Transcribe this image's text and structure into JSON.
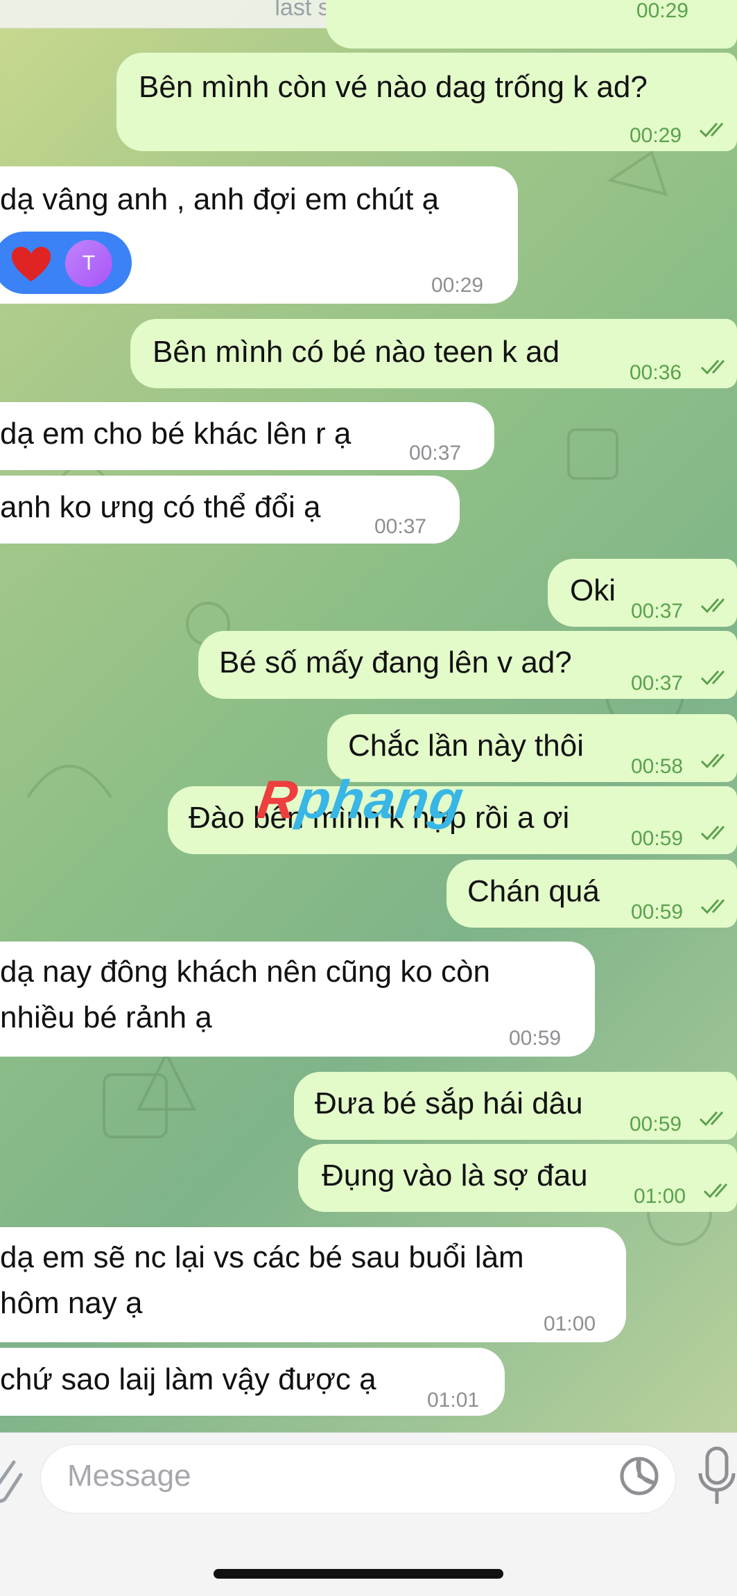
{
  "header": {
    "status": "last seen just now"
  },
  "messages": [
    {
      "dir": "out",
      "text": "",
      "time": "00:29"
    },
    {
      "dir": "out",
      "text": "Bên mình còn vé nào dag trống k ad?",
      "time": "00:29"
    },
    {
      "dir": "in",
      "text": "dạ vâng anh , anh đợi em chút ạ",
      "time": "00:29",
      "reaction": {
        "emoji": "❤️",
        "user_initial": "T"
      }
    },
    {
      "dir": "out",
      "text": "Bên mình có bé nào teen k ad",
      "time": "00:36"
    },
    {
      "dir": "in",
      "text": "dạ em cho bé khác lên r ạ",
      "time": "00:37"
    },
    {
      "dir": "in",
      "text": "anh ko ưng có thể đổi ạ",
      "time": "00:37"
    },
    {
      "dir": "out",
      "text": "Oki",
      "time": "00:37"
    },
    {
      "dir": "out",
      "text": "Bé số mấy đang lên v ad?",
      "time": "00:37"
    },
    {
      "dir": "out",
      "text": "Chắc lần này thôi",
      "time": "00:58"
    },
    {
      "dir": "out",
      "text": "Đào bên mình k hợp rồi a ơi",
      "time": "00:59"
    },
    {
      "dir": "out",
      "text": "Chán quá",
      "time": "00:59"
    },
    {
      "dir": "in",
      "lines": [
        "dạ nay đông khách nên cũng ko còn",
        "nhiều bé rảnh ạ"
      ],
      "time": "00:59"
    },
    {
      "dir": "out",
      "text": "Đưa bé sắp hái dâu",
      "time": "00:59"
    },
    {
      "dir": "out",
      "text": "Đụng vào là sợ đau",
      "time": "01:00"
    },
    {
      "dir": "in",
      "lines": [
        "dạ em sẽ nc lại vs các bé sau buổi làm",
        "hôm nay ạ"
      ],
      "time": "01:00"
    },
    {
      "dir": "in",
      "text": "chứ sao laij làm vậy được ạ",
      "time": "01:01"
    }
  ],
  "watermark": {
    "part1": "R",
    "part2": "phang"
  },
  "composer": {
    "placeholder": "Message"
  },
  "colors": {
    "outgoing": "#e3fbc9",
    "incoming": "#ffffff",
    "outgoing_time": "#5aa14d",
    "reaction_bg": "#3b82f6"
  },
  "icons": [
    "attach-icon",
    "sticker-icon",
    "mic-icon",
    "double-check-icon",
    "heart-icon"
  ]
}
